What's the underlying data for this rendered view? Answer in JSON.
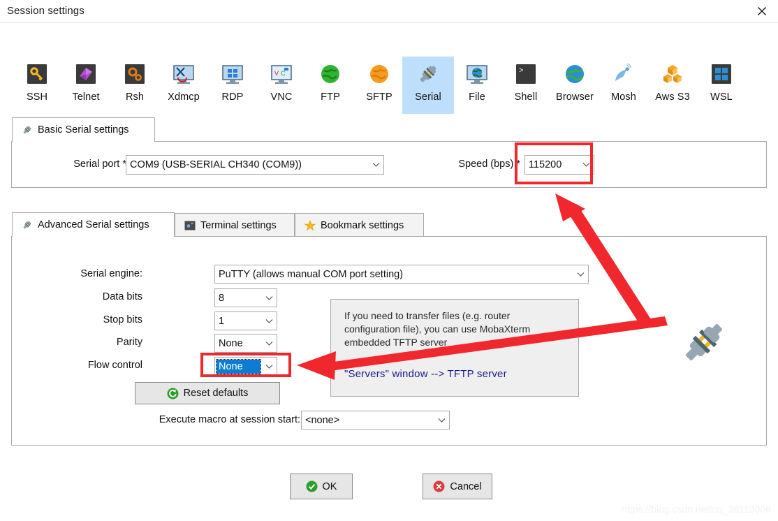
{
  "window": {
    "title": "Session settings",
    "close_icon": "close-icon"
  },
  "toolbar": {
    "items": [
      {
        "label": "SSH",
        "icon": "key-icon"
      },
      {
        "label": "Telnet",
        "icon": "telnet-cube-icon"
      },
      {
        "label": "Rsh",
        "icon": "gears-icon"
      },
      {
        "label": "Xdmcp",
        "icon": "xdmcp-monitor-icon"
      },
      {
        "label": "RDP",
        "icon": "rdp-monitor-icon"
      },
      {
        "label": "VNC",
        "icon": "vnc-monitor-icon"
      },
      {
        "label": "FTP",
        "icon": "green-globe-icon"
      },
      {
        "label": "SFTP",
        "icon": "orange-globe-icon"
      },
      {
        "label": "Serial",
        "icon": "serial-plug-icon",
        "selected": true
      },
      {
        "label": "File",
        "icon": "file-monitor-icon"
      },
      {
        "label": "Shell",
        "icon": "shell-prompt-icon"
      },
      {
        "label": "Browser",
        "icon": "browser-globe-icon"
      },
      {
        "label": "Mosh",
        "icon": "satellite-dish-icon"
      },
      {
        "label": "Aws S3",
        "icon": "aws-cubes-icon"
      },
      {
        "label": "WSL",
        "icon": "windows-icon"
      }
    ]
  },
  "basic": {
    "tab_label": "Basic Serial settings",
    "tab_icon": "serial-plug-icon",
    "serial_port_label": "Serial port *",
    "serial_port_value": "COM9  (USB-SERIAL CH340 (COM9))",
    "speed_label": "Speed (bps) *",
    "speed_value": "115200"
  },
  "advanced": {
    "tabs": [
      {
        "label": "Advanced Serial settings",
        "icon": "serial-plug-icon",
        "active": true
      },
      {
        "label": "Terminal settings",
        "icon": "terminal-icon",
        "active": false
      },
      {
        "label": "Bookmark settings",
        "icon": "star-icon",
        "active": false
      }
    ],
    "serial_engine_label": "Serial engine:",
    "serial_engine_value": "PuTTY   (allows manual COM port setting)",
    "data_bits_label": "Data bits",
    "data_bits_value": "8",
    "stop_bits_label": "Stop bits",
    "stop_bits_value": "1",
    "parity_label": "Parity",
    "parity_value": "None",
    "flow_control_label": "Flow control",
    "flow_control_value": "None",
    "reset_button_label": "Reset defaults",
    "reset_button_icon": "reset-circle-icon",
    "macro_label": "Execute macro at session start:",
    "macro_value": "<none>"
  },
  "infobox": {
    "text": "If you need to transfer files (e.g. router configuration file), you can use MobaXterm embedded TFTP server",
    "link_text": "\"Servers\" window  -->  TFTP server"
  },
  "footer": {
    "ok_label": "OK",
    "ok_icon": "check-circle-icon",
    "cancel_label": "Cancel",
    "cancel_icon": "x-circle-icon"
  },
  "annotations": {
    "highlight_color": "#f0282d",
    "arrow_color": "#f0282d",
    "speed_highlight": "speed-field-highlight",
    "flow_highlight": "flow-control-highlight",
    "arrow_to_speed": "arrow-pointing-to-speed",
    "arrow_to_flow": "arrow-pointing-to-flow-control"
  },
  "watermark": {
    "text": "https://blog.csdn.net/qq_38113006"
  },
  "decor": {
    "plug_icon": "large-serial-plug-icon"
  }
}
